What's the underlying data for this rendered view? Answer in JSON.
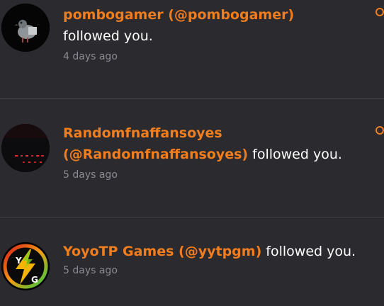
{
  "notifications": [
    {
      "user_link": "pombogamer (@pombogamer)",
      "action": "followed you.",
      "time": "4 days ago",
      "avatar_icon": "pigeon-avatar-icon"
    },
    {
      "user_link_line1": "Randomfnaffansoyes",
      "user_link_line2": "(@Randomfnaffansoyes)",
      "action": "followed you.",
      "time": "5 days ago",
      "avatar_icon": "dark-scene-avatar-icon"
    },
    {
      "user_link": "YoyoTP Games (@yytpgm)",
      "action": "followed you.",
      "time": "5 days ago",
      "avatar_icon": "lightning-logo-avatar-icon",
      "avatar_letters": [
        "Y",
        "G"
      ]
    }
  ],
  "colors": {
    "background": "#2b2a2e",
    "accent": "#f07d1e",
    "muted_text": "#8b8a90",
    "divider": "#46454a"
  }
}
